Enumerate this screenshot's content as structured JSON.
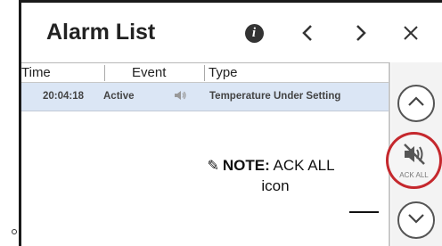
{
  "header": {
    "title": "Alarm List",
    "icons": [
      "info-icon",
      "chevron-left-icon",
      "chevron-right-icon",
      "close-icon"
    ]
  },
  "table": {
    "columns": [
      "Time",
      "Event",
      "Type"
    ],
    "rows": [
      {
        "time": "20:04:18",
        "event": "Active",
        "sound_icon": "speaker-icon",
        "type": "Temperature Under Setting"
      }
    ]
  },
  "rail": {
    "ack_all_label": "ACK ALL",
    "icons": [
      "chevron-up-icon",
      "mute-speaker-icon",
      "chevron-down-icon"
    ]
  },
  "note": {
    "label": "NOTE:",
    "text_line1": "ACK ALL",
    "text_line2": "icon"
  },
  "colors": {
    "row_highlight": "#dbe6f5",
    "callout_ring": "#c5282d"
  }
}
